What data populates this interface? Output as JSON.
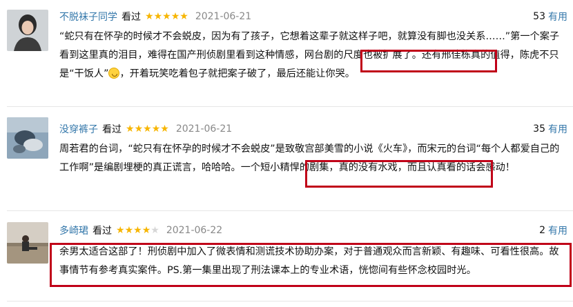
{
  "reviews": [
    {
      "user": "不脱袜子同学",
      "status": "看过",
      "rating": 5,
      "date": "2021-06-21",
      "useful_count": "53",
      "useful_label": "有用",
      "avatar_icon": "avatar-woman-portrait",
      "text_before": "“蛇只有在怀孕的时候才不会蜕皮，因为有了孩子，它想着这辈子就这样子吧，就算没有脚也没关系……”第一个案子看到这里真的泪目，难得在国产刑侦剧里看到这种情感，网台剧的尺度也被扩展了。还有邢佳栋真的值得，陈虎不只是“干饭人”",
      "emoji_icon": "crying-laughing-face-icon",
      "text_after": "，开着玩笑吃着包子就把案子破了，最后还能让你哭。"
    },
    {
      "user": "没穿裤子",
      "status": "看过",
      "rating": 5,
      "date": "2021-06-21",
      "useful_count": "35",
      "useful_label": "有用",
      "avatar_icon": "avatar-blurred-person",
      "text": "周若君的台词，“蛇只有在怀孕的时候才不会蜕皮”是致敬宫部美雪的小说《火车》，而宋元的台词“每个人都爱自己的工作啊”是编剧埋梗的真正谎言，哈哈哈。一个短小精悍的剧集，真的没有水戏，而且认真看的话会感动！"
    },
    {
      "user": "多崎珺",
      "status": "看过",
      "rating": 4,
      "date": "2021-06-22",
      "useful_count": "2",
      "useful_label": "有用",
      "avatar_icon": "avatar-person-sitting-desert",
      "text": "余男太适合这部了！刑侦剧中加入了微表情和测谎技术协助办案，对于普通观众而言新颖、有趣味、可看性很高。故事情节有参考真实案件。PS.第一集里出现了刑法课本上的专业术语，恍惚间有些怀念校园时光。"
    }
  ],
  "colors": {
    "username": "#3377aa",
    "star_on": "#f7b500",
    "highlight_box": "#c00018"
  }
}
